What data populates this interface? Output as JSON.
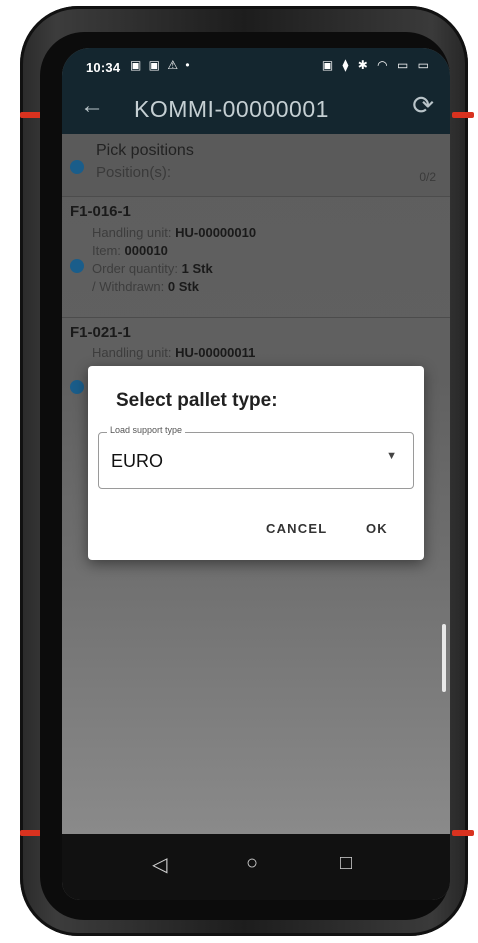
{
  "status_bar": {
    "time": "10:34",
    "left_icons": "▣ ▣ ⚠ •",
    "right_icons": "▣ ⧫ ✱ ◠ ▭ ▭"
  },
  "app_bar": {
    "back_icon": "←",
    "title": "KOMMI-00000001",
    "sync_icon": "⟳"
  },
  "pick_positions": {
    "title": "Pick positions",
    "subtitle": "Position(s):",
    "count": "0/2"
  },
  "items": [
    {
      "title": "F1-016-1",
      "handling_unit_label": "Handling unit:",
      "handling_unit_value": "HU-00000010",
      "item_label": "Item:",
      "item_value": "000010",
      "order_qty_label": "Order quantity:",
      "order_qty_value": "1 Stk",
      "withdrawn_label": "/ Withdrawn:",
      "withdrawn_value": "0 Stk"
    },
    {
      "title": "F1-021-1",
      "handling_unit_label": "Handling unit:",
      "handling_unit_value": "HU-00000011"
    }
  ],
  "dialog": {
    "title": "Select pallet type:",
    "field_label": "Load support type",
    "field_value": "EURO",
    "cancel_label": "CANCEL",
    "ok_label": "OK"
  },
  "nav_bar": {
    "back": "◁",
    "home": "○",
    "recents": "□"
  },
  "colors": {
    "app_bar": "#14262f",
    "accent_dot": "#1a5d8a",
    "device_accent": "#d9321f"
  }
}
